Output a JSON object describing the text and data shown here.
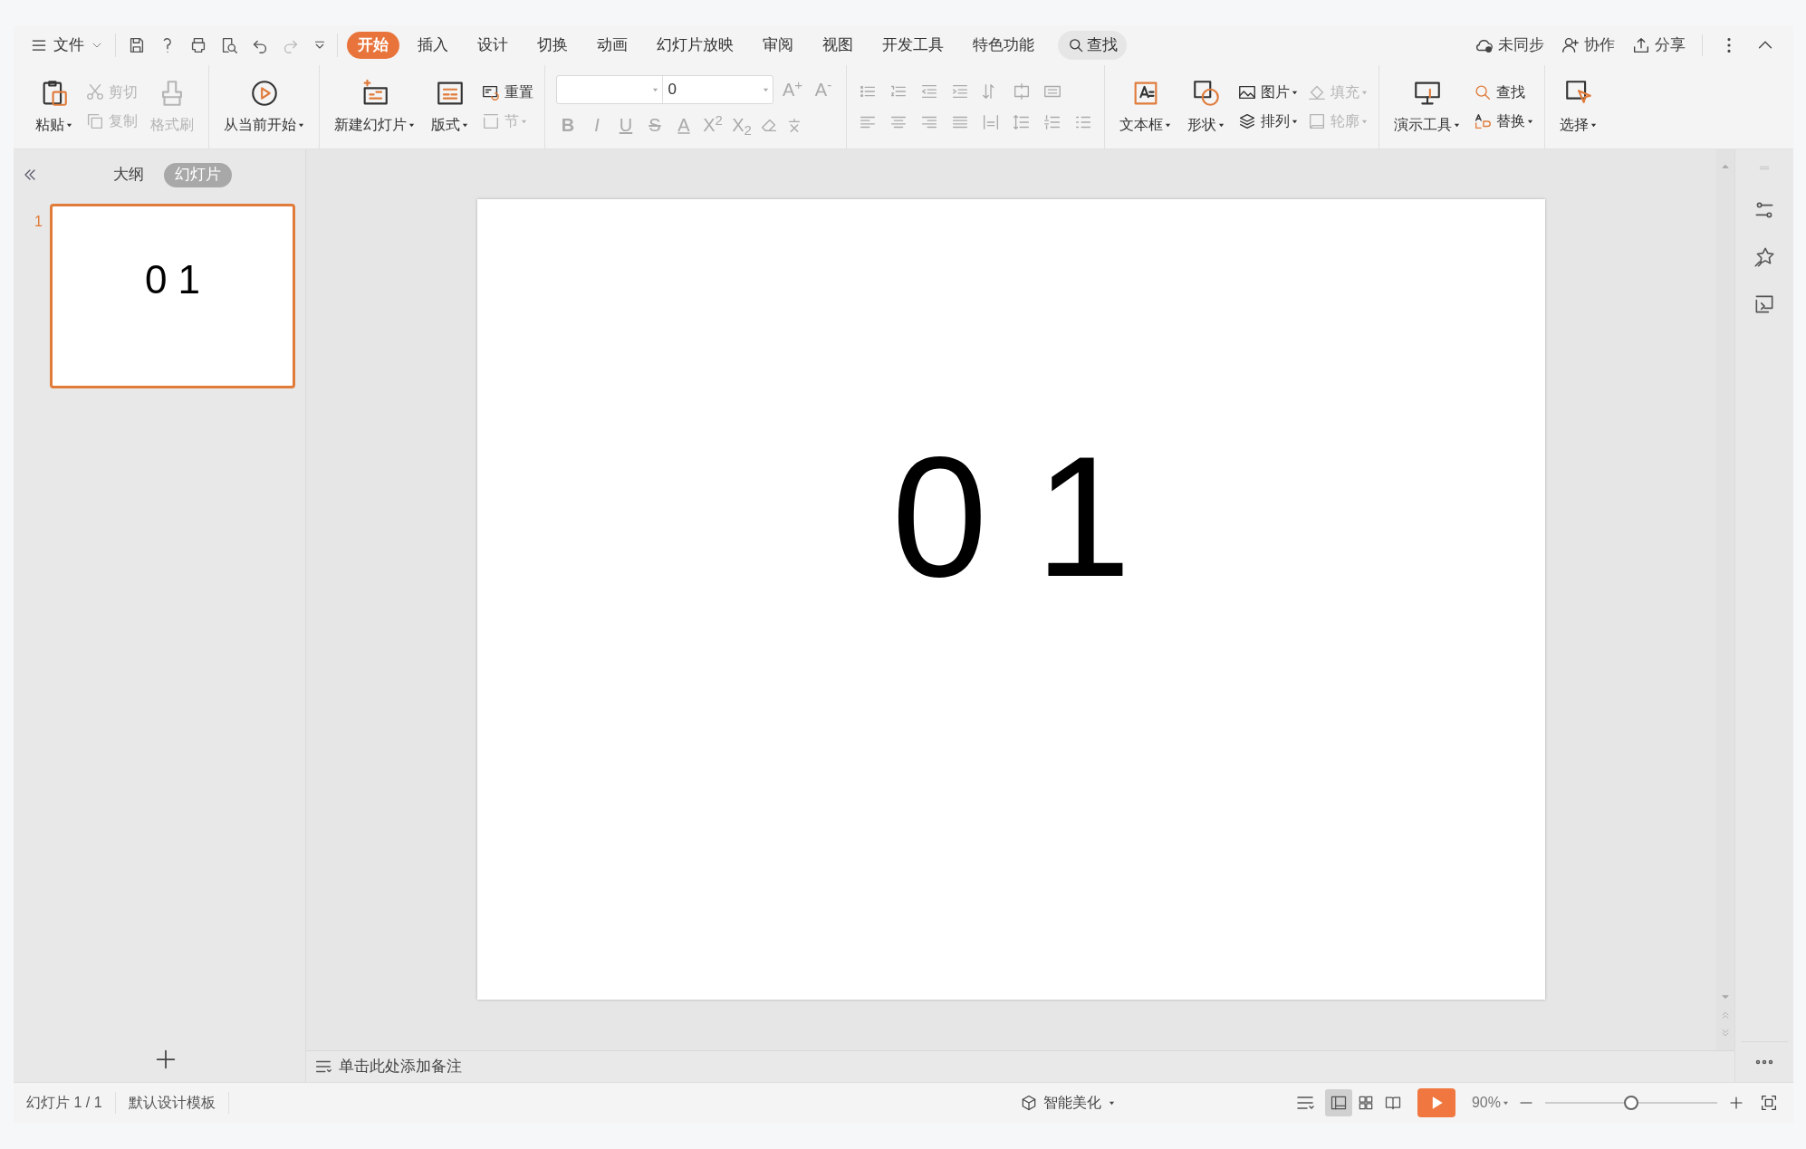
{
  "menu_bar": {
    "file_menu": "文件",
    "tabs": [
      {
        "label": "开始",
        "selected": true
      },
      {
        "label": "插入",
        "selected": false
      },
      {
        "label": "设计",
        "selected": false
      },
      {
        "label": "切换",
        "selected": false
      },
      {
        "label": "动画",
        "selected": false
      },
      {
        "label": "幻灯片放映",
        "selected": false
      },
      {
        "label": "审阅",
        "selected": false
      },
      {
        "label": "视图",
        "selected": false
      },
      {
        "label": "开发工具",
        "selected": false
      },
      {
        "label": "特色功能",
        "selected": false
      }
    ],
    "search": "查找",
    "actions": [
      "未同步",
      "协作",
      "分享"
    ]
  },
  "ribbon": {
    "groups": [
      {
        "columns": [
          {
            "kind": "large",
            "label": "粘贴",
            "disabled": false,
            "dropdown": true
          },
          {
            "kind": "pair",
            "items": [
              {
                "label": "剪切",
                "disabled": true,
                "dropdown": false
              },
              {
                "label": "复制",
                "disabled": true,
                "dropdown": false
              }
            ]
          },
          {
            "kind": "large",
            "label": "格式刷",
            "disabled": true,
            "dropdown": false
          }
        ]
      },
      {
        "columns": [
          {
            "kind": "large",
            "label": "从当前开始",
            "disabled": false,
            "dropdown": true
          }
        ]
      },
      {
        "columns": [
          {
            "kind": "large",
            "label": "新建幻灯片",
            "disabled": false,
            "dropdown": true
          },
          {
            "kind": "large",
            "label": "版式",
            "disabled": false,
            "dropdown": true
          },
          {
            "kind": "pair",
            "items": [
              {
                "label": "重置",
                "disabled": false,
                "dropdown": false
              },
              {
                "label": "节",
                "disabled": true,
                "dropdown": true
              }
            ]
          }
        ]
      },
      {
        "columns": [
          {
            "kind": "font",
            "size": "0",
            "buttons": [
              "A$^{+}$",
              "A$^{-}$",
              "B",
              "I",
              "U",
              "S",
              "A",
              "X$^{2}$",
              "X$_{2}$"
            ]
          }
        ]
      },
      {
        "columns": [
          {
            "kind": "paragraph"
          }
        ]
      },
      {
        "columns": [
          {
            "kind": "large",
            "label": "文本框",
            "disabled": false,
            "dropdown": true
          },
          {
            "kind": "large",
            "label": "形状",
            "disabled": false,
            "dropdown": true
          },
          {
            "kind": "pair",
            "items": [
              {
                "label": "图片",
                "disabled": false,
                "dropdown": true
              },
              {
                "label": "排列",
                "disabled": false,
                "dropdown": true
              }
            ]
          },
          {
            "kind": "pair",
            "items": [
              {
                "label": "填充",
                "disabled": true,
                "dropdown": true
              },
              {
                "label": "轮廓",
                "disabled": true,
                "dropdown": true
              }
            ]
          }
        ]
      },
      {
        "columns": [
          {
            "kind": "large",
            "label": "演示工具",
            "disabled": false,
            "dropdown": true
          },
          {
            "kind": "pair",
            "items": [
              {
                "label": "查找",
                "disabled": false,
                "dropdown": false
              },
              {
                "label": "替换",
                "disabled": false,
                "dropdown": true
              }
            ]
          }
        ]
      },
      {
        "columns": [
          {
            "kind": "large",
            "label": "选择",
            "disabled": false,
            "dropdown": true
          }
        ]
      }
    ]
  },
  "slide_panel": {
    "tabs": [
      {
        "label": "大纲",
        "selected": false
      },
      {
        "label": "幻灯片",
        "selected": true
      }
    ],
    "slides": [
      {
        "number": "1",
        "text": "0 1",
        "selected": true
      }
    ]
  },
  "slide": {
    "text": "0 1"
  },
  "notes": {
    "placeholder": "单击此处添加备注"
  },
  "status_bar": {
    "slide_info": "幻灯片 1 / 1",
    "template": "默认设计模板",
    "beautify": "智能美化",
    "views": [
      {
        "kind": "normal",
        "selected": true
      },
      {
        "kind": "sorter",
        "selected": false
      },
      {
        "kind": "reading",
        "selected": false
      }
    ],
    "zoom": "90%",
    "zoom_slider": {
      "level": 0.5
    }
  }
}
